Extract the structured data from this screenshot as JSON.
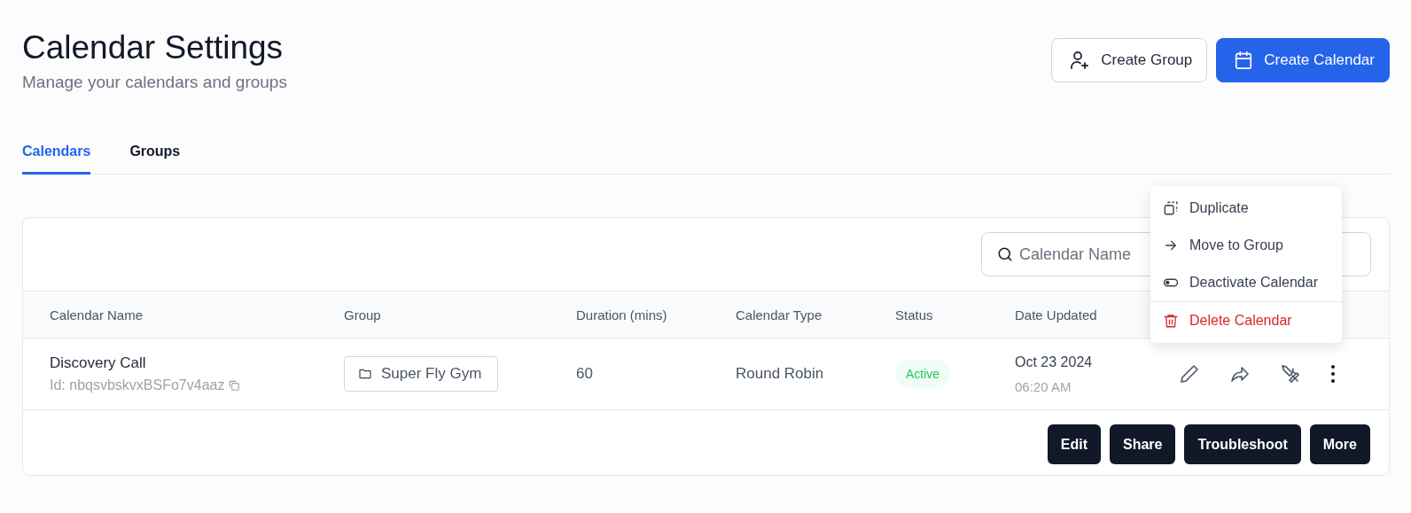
{
  "header": {
    "title": "Calendar Settings",
    "subtitle": "Manage your calendars and groups"
  },
  "header_buttons": [
    {
      "label": "Create Group",
      "kind": "secondary"
    },
    {
      "label": "Create Calendar",
      "kind": "primary"
    }
  ],
  "tabs": [
    {
      "label": "Calendars",
      "selected": true
    },
    {
      "label": "Groups",
      "selected": false
    }
  ],
  "search": {
    "placeholder": "Calendar Name"
  },
  "table": {
    "columns": [
      "Calendar Name",
      "Group",
      "Duration (mins)",
      "Calendar Type",
      "Status",
      "Date Updated"
    ],
    "rows": [
      {
        "name": "Discovery Call",
        "id": "Id: nbqsvbskvxBSFo7v4aaz",
        "group": "Super Fly Gym",
        "duration": "60",
        "type": "Round Robin",
        "status": "Active",
        "date": "Oct 23 2024",
        "time": "06:20 AM"
      }
    ]
  },
  "footer_buttons": [
    "Edit",
    "Share",
    "Troubleshoot",
    "More"
  ],
  "menu": [
    {
      "label": "Duplicate",
      "kind": "duplicate"
    },
    {
      "label": "Move to Group",
      "kind": "move"
    },
    {
      "label": "Deactivate Calendar",
      "kind": "toggle"
    },
    {
      "label": "Delete Calendar",
      "kind": "delete"
    }
  ]
}
